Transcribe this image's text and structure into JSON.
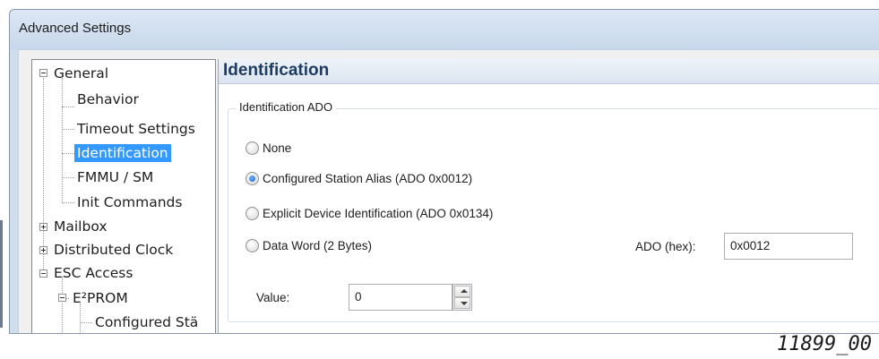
{
  "window": {
    "title": "Advanced Settings"
  },
  "tree": {
    "items": [
      {
        "label": "General",
        "expander": "minus",
        "selected": false
      },
      {
        "label": "Behavior",
        "selected": false
      },
      {
        "label": "Timeout Settings",
        "selected": false
      },
      {
        "label": "Identification",
        "selected": true
      },
      {
        "label": "FMMU / SM",
        "selected": false
      },
      {
        "label": "Init Commands",
        "selected": false
      },
      {
        "label": "Mailbox",
        "expander": "plus",
        "selected": false
      },
      {
        "label": "Distributed Clock",
        "expander": "plus",
        "selected": false
      },
      {
        "label": "ESC Access",
        "expander": "minus",
        "selected": false
      },
      {
        "label": "E²PROM",
        "expander": "minus",
        "selected": false
      },
      {
        "label": "Configured Stä",
        "selected": false
      }
    ]
  },
  "panel": {
    "title": "Identification",
    "group_label": "Identification ADO",
    "radio_options": [
      {
        "label": "None",
        "checked": false
      },
      {
        "label": "Configured Station Alias (ADO 0x0012)",
        "checked": true
      },
      {
        "label": "Explicit Device Identification (ADO 0x0134)",
        "checked": false
      },
      {
        "label": "Data Word (2 Bytes)",
        "checked": false
      }
    ],
    "ado_label": "ADO (hex):",
    "ado_value": "0x0012",
    "value_label": "Value:",
    "value_value": "0"
  },
  "figure_id": "11899_00",
  "colors": {
    "selection": "#3399ff",
    "title_bar": "#cfdcec",
    "panel_title": "#1e3b5e"
  }
}
